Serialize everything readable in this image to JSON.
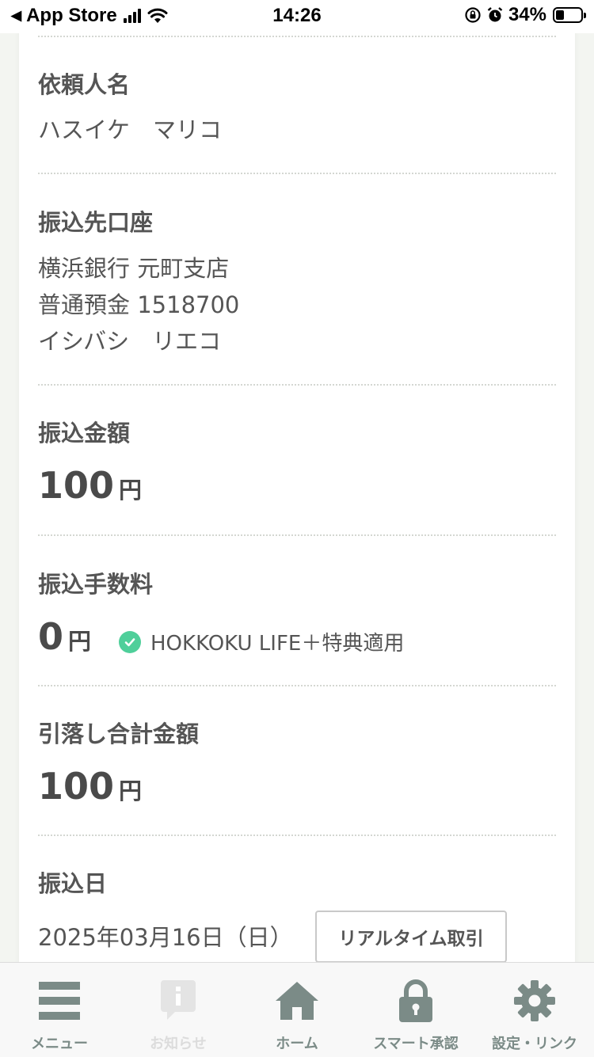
{
  "status_bar": {
    "back_app": "App Store",
    "time": "14:26",
    "battery_percent": "34%",
    "battery_level": 0.34
  },
  "sections": {
    "requester": {
      "label": "依頼人名",
      "value": "ハスイケ　マリコ"
    },
    "destination_account": {
      "label": "振込先口座",
      "lines": [
        "横浜銀行 元町支店",
        "普通預金 1518700",
        "イシバシ　リエコ"
      ]
    },
    "transfer_amount": {
      "label": "振込金額",
      "value": "100",
      "unit": "円"
    },
    "transfer_fee": {
      "label": "振込手数料",
      "value": "0",
      "unit": "円",
      "note": "HOKKOKU LIFE＋特典適用"
    },
    "total_debit": {
      "label": "引落し合計金額",
      "value": "100",
      "unit": "円"
    },
    "transfer_date": {
      "label": "振込日",
      "value": "2025年03月16日（日）",
      "button_label": "リアルタイム取引"
    }
  },
  "tab_bar": {
    "items": [
      {
        "label": "メニュー",
        "icon": "menu-icon",
        "enabled": true
      },
      {
        "label": "お知らせ",
        "icon": "info-icon",
        "enabled": false
      },
      {
        "label": "ホーム",
        "icon": "home-icon",
        "enabled": true
      },
      {
        "label": "スマート承認",
        "icon": "lock-icon",
        "enabled": true
      },
      {
        "label": "設定・リンク",
        "icon": "gear-icon",
        "enabled": true
      }
    ]
  },
  "colors": {
    "accent": "#7b8b87",
    "check": "#4fcf9a",
    "text": "#4d4d4d"
  }
}
